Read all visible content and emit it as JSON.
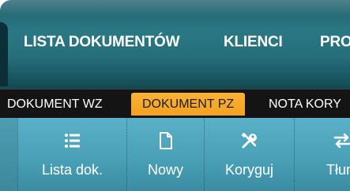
{
  "nav": {
    "items": [
      {
        "label": "LISTA DOKUMENTÓW"
      },
      {
        "label": "KLIENCI"
      },
      {
        "label": "PRO"
      }
    ]
  },
  "doc_tabs": {
    "items": [
      {
        "label": "DOKUMENT WZ",
        "active": false
      },
      {
        "label": "DOKUMENT PZ",
        "active": true
      },
      {
        "label": "NOTA KORY",
        "active": false
      }
    ]
  },
  "toolbar": {
    "buttons": [
      {
        "label": "Lista dok.",
        "icon": "list-icon"
      },
      {
        "label": "Nowy",
        "icon": "new-document-icon"
      },
      {
        "label": "Koryguj",
        "icon": "tools-icon"
      },
      {
        "label": "Tłum",
        "icon": "transfer-icon"
      }
    ]
  },
  "colors": {
    "nav_background": "#2b7885",
    "tab_bar_background": "#141414",
    "active_tab": "#f4a11e",
    "toolbar_background": "#4aa1b7",
    "text": "#ffffff"
  }
}
